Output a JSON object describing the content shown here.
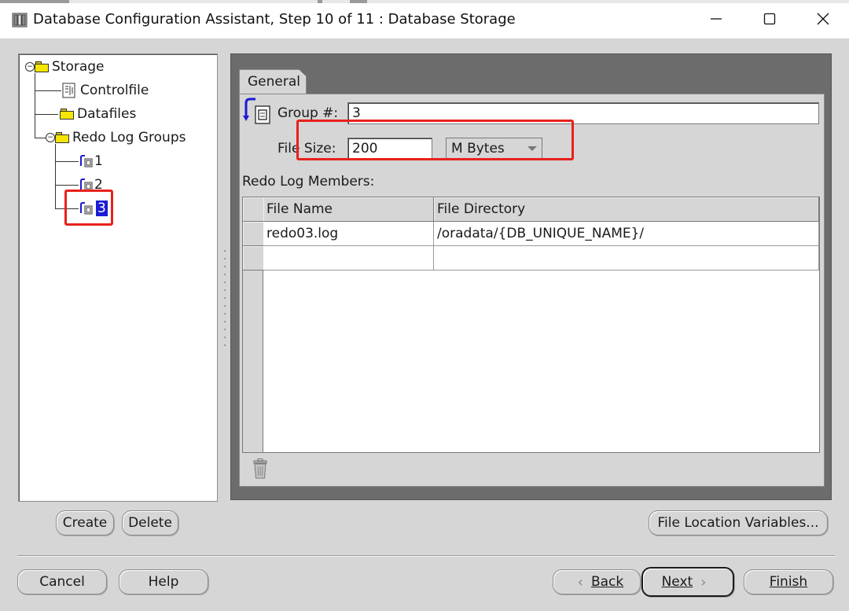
{
  "window": {
    "title": "Database Configuration Assistant, Step 10 of 11 : Database Storage"
  },
  "tree": {
    "root": "Storage",
    "controlfile": "Controlfile",
    "datafiles": "Datafiles",
    "redo_groups": "Redo Log Groups",
    "group1": "1",
    "group2": "2",
    "group3": "3"
  },
  "tab": {
    "label": "General"
  },
  "form": {
    "group_label": "Group #:",
    "group_value": "3",
    "filesize_label": "File Size:",
    "filesize_value": "200",
    "unit_value": "M Bytes",
    "members_label": "Redo Log Members:"
  },
  "table": {
    "columns": [
      "File Name",
      "File Directory"
    ],
    "rows": [
      [
        "redo03.log",
        "/oradata/{DB_UNIQUE_NAME}/"
      ],
      [
        "",
        ""
      ]
    ]
  },
  "buttons": {
    "create": "Create",
    "delete": "Delete",
    "file_location": "File Location Variables...",
    "cancel": "Cancel",
    "help": "Help",
    "back": "Back",
    "next": "Next",
    "finish": "Finish"
  },
  "colors": {
    "highlight": "#e8211c",
    "selection": "#1b1bd6"
  }
}
